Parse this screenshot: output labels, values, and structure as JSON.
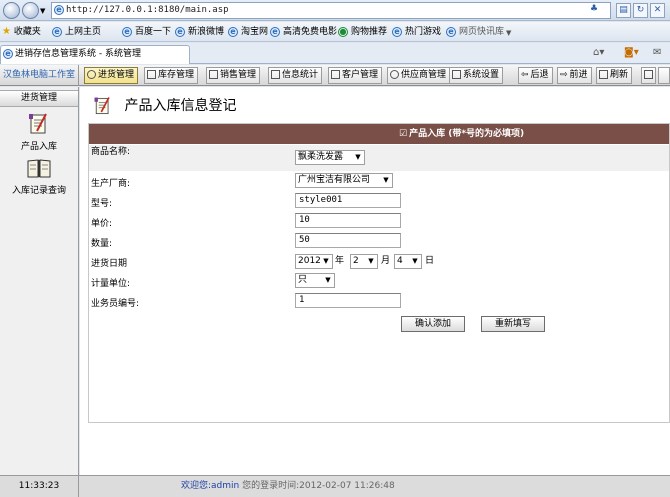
{
  "browser": {
    "url": "http://127.0.0.1:8180/main.asp",
    "favorites_label": "收藏夹",
    "favorites": [
      "上网主页",
      "百度一下",
      "新浪微博",
      "淘宝网",
      "高清免费电影",
      "购物推荐",
      "热门游戏",
      "网页快讯库"
    ],
    "tab_title": "进销存信息管理系统 - 系统管理"
  },
  "app": {
    "brand": "汉鱼林电脑工作室",
    "menu": [
      "进货管理",
      "库存管理",
      "销售管理",
      "信息统计",
      "客户管理",
      "供应商管理",
      "系统设置"
    ],
    "nav": {
      "back": "后退",
      "forward": "前进",
      "refresh": "刷新"
    }
  },
  "sidebar": {
    "title": "进货管理",
    "items": [
      {
        "label": "产品入库",
        "icon": "notepad-icon"
      },
      {
        "label": "入库记录查询",
        "icon": "book-icon"
      }
    ]
  },
  "page": {
    "title": "产品入库信息登记"
  },
  "form": {
    "header": "产品入库 (带*号的为必填项)",
    "product_name_label": "商品名称:",
    "product_name_value": "飘柔洗发露",
    "manufacturer_label": "生产厂商:",
    "manufacturer_value": "广州宝洁有限公司",
    "model_label": "型号:",
    "model_value": "style001",
    "price_label": "单价:",
    "price_value": "10",
    "quantity_label": "数量:",
    "quantity_value": "50",
    "date_label": "进货日期",
    "date_year": "2012",
    "date_year_unit": "年",
    "date_month": "2",
    "date_month_unit": "月",
    "date_day": "4",
    "date_day_unit": "日",
    "unit_label": "计量单位:",
    "unit_value": "只",
    "staff_label": "业务员编号:",
    "staff_value": "1",
    "submit_label": "确认添加",
    "reset_label": "重新填写"
  },
  "status": {
    "time": "11:33:23",
    "welcome": "欢迎您:admin",
    "login_info": "您的登录时间:2012-02-07 11:26:48"
  },
  "colors": {
    "header_bg": "#7a4f47",
    "brand_text": "#2a62b0",
    "welcome_text": "#1f3fa8"
  }
}
